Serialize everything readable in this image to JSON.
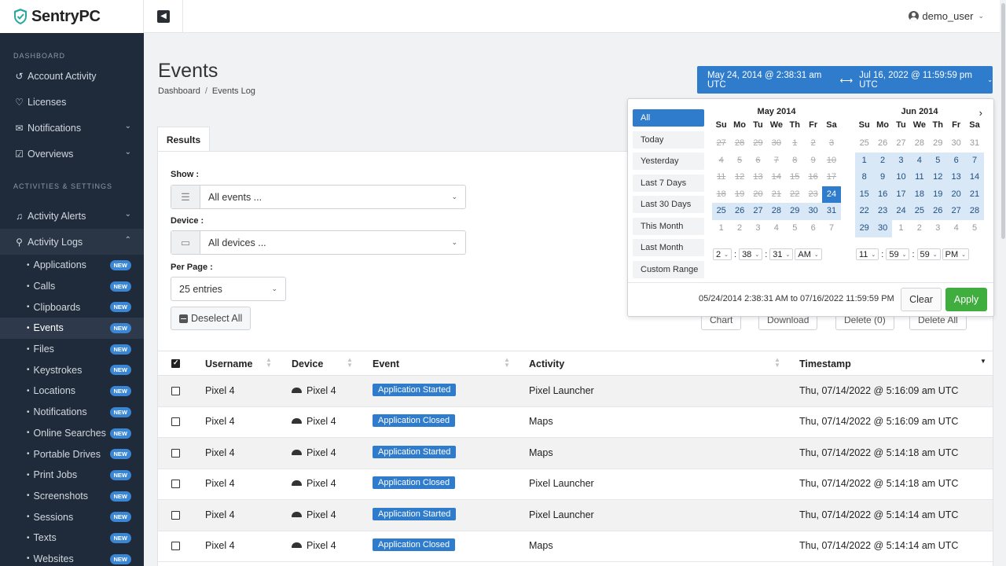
{
  "brand": {
    "name": "SentryPC"
  },
  "sidebar": {
    "section1": "DASHBOARD",
    "section2": "ACTIVITIES & SETTINGS",
    "items": [
      {
        "label": "Account Activity"
      },
      {
        "label": "Licenses"
      },
      {
        "label": "Notifications"
      },
      {
        "label": "Overviews"
      },
      {
        "label": "Activity Alerts"
      },
      {
        "label": "Activity Logs"
      }
    ],
    "subitems": [
      {
        "label": "Applications",
        "badge": "NEW"
      },
      {
        "label": "Calls",
        "badge": "NEW"
      },
      {
        "label": "Clipboards",
        "badge": "NEW"
      },
      {
        "label": "Events",
        "badge": "NEW"
      },
      {
        "label": "Files",
        "badge": "NEW"
      },
      {
        "label": "Keystrokes",
        "badge": "NEW"
      },
      {
        "label": "Locations",
        "badge": "NEW"
      },
      {
        "label": "Notifications",
        "badge": "NEW"
      },
      {
        "label": "Online Searches",
        "badge": "NEW"
      },
      {
        "label": "Portable Drives",
        "badge": "NEW"
      },
      {
        "label": "Print Jobs",
        "badge": "NEW"
      },
      {
        "label": "Screenshots",
        "badge": "NEW"
      },
      {
        "label": "Sessions",
        "badge": "NEW"
      },
      {
        "label": "Texts",
        "badge": "NEW"
      },
      {
        "label": "Websites",
        "badge": "NEW"
      }
    ]
  },
  "topbar": {
    "user": "demo_user"
  },
  "header": {
    "title": "Events",
    "breadcrumb": [
      "Dashboard",
      "Events Log"
    ],
    "date_from": "May 24, 2014 @ 2:38:31 am UTC",
    "date_to": "Jul 16, 2022 @ 11:59:59 pm UTC"
  },
  "tabs": {
    "results": "Results"
  },
  "filters": {
    "show_label": "Show :",
    "show_value": "All events ...",
    "device_label": "Device :",
    "device_value": "All devices ...",
    "perpage_label": "Per Page :",
    "perpage_value": "25 entries",
    "deselect": "Deselect All"
  },
  "toolbar": {
    "chart": "Chart",
    "download": "Download",
    "delete": "Delete (0)",
    "delete_all": "Delete All"
  },
  "table": {
    "columns": [
      "Username",
      "Device",
      "Event",
      "Activity",
      "Timestamp"
    ],
    "rows": [
      {
        "user": "Pixel 4",
        "device": "Pixel 4",
        "event": "Application Started",
        "activity": "Pixel Launcher",
        "time": "Thu, 07/14/2022 @ 5:16:09 am UTC"
      },
      {
        "user": "Pixel 4",
        "device": "Pixel 4",
        "event": "Application Closed",
        "activity": "Maps",
        "time": "Thu, 07/14/2022 @ 5:16:09 am UTC"
      },
      {
        "user": "Pixel 4",
        "device": "Pixel 4",
        "event": "Application Started",
        "activity": "Maps",
        "time": "Thu, 07/14/2022 @ 5:14:18 am UTC"
      },
      {
        "user": "Pixel 4",
        "device": "Pixel 4",
        "event": "Application Closed",
        "activity": "Pixel Launcher",
        "time": "Thu, 07/14/2022 @ 5:14:18 am UTC"
      },
      {
        "user": "Pixel 4",
        "device": "Pixel 4",
        "event": "Application Started",
        "activity": "Pixel Launcher",
        "time": "Thu, 07/14/2022 @ 5:14:14 am UTC"
      },
      {
        "user": "Pixel 4",
        "device": "Pixel 4",
        "event": "Application Closed",
        "activity": "Maps",
        "time": "Thu, 07/14/2022 @ 5:14:14 am UTC"
      }
    ]
  },
  "picker": {
    "ranges": [
      "All",
      "Today",
      "Yesterday",
      "Last 7 Days",
      "Last 30 Days",
      "This Month",
      "Last Month",
      "Custom Range"
    ],
    "dow": [
      "Su",
      "Mo",
      "Tu",
      "We",
      "Th",
      "Fr",
      "Sa"
    ],
    "left_month": "May 2014",
    "right_month": "Jun 2014",
    "left_days": [
      [
        "27",
        "28",
        "29",
        "30",
        "1",
        "2",
        "3"
      ],
      [
        "4",
        "5",
        "6",
        "7",
        "8",
        "9",
        "10"
      ],
      [
        "11",
        "12",
        "13",
        "14",
        "15",
        "16",
        "17"
      ],
      [
        "18",
        "19",
        "20",
        "21",
        "22",
        "23",
        "24"
      ],
      [
        "25",
        "26",
        "27",
        "28",
        "29",
        "30",
        "31"
      ],
      [
        "1",
        "2",
        "3",
        "4",
        "5",
        "6",
        "7"
      ]
    ],
    "right_days": [
      [
        "25",
        "26",
        "27",
        "28",
        "29",
        "30",
        "31"
      ],
      [
        "1",
        "2",
        "3",
        "4",
        "5",
        "6",
        "7"
      ],
      [
        "8",
        "9",
        "10",
        "11",
        "12",
        "13",
        "14"
      ],
      [
        "15",
        "16",
        "17",
        "18",
        "19",
        "20",
        "21"
      ],
      [
        "22",
        "23",
        "24",
        "25",
        "26",
        "27",
        "28"
      ],
      [
        "29",
        "30",
        "1",
        "2",
        "3",
        "4",
        "5"
      ]
    ],
    "left_time": [
      "2",
      "38",
      "31",
      "AM"
    ],
    "right_time": [
      "11",
      "59",
      "59",
      "PM"
    ],
    "summary": "05/24/2014 2:38:31 AM to 07/16/2022 11:59:59 PM",
    "clear": "Clear",
    "apply": "Apply"
  },
  "colors": {
    "accent": "#2f7bcc",
    "apply": "#3fae3f",
    "sidebar": "#1f2b3a"
  }
}
